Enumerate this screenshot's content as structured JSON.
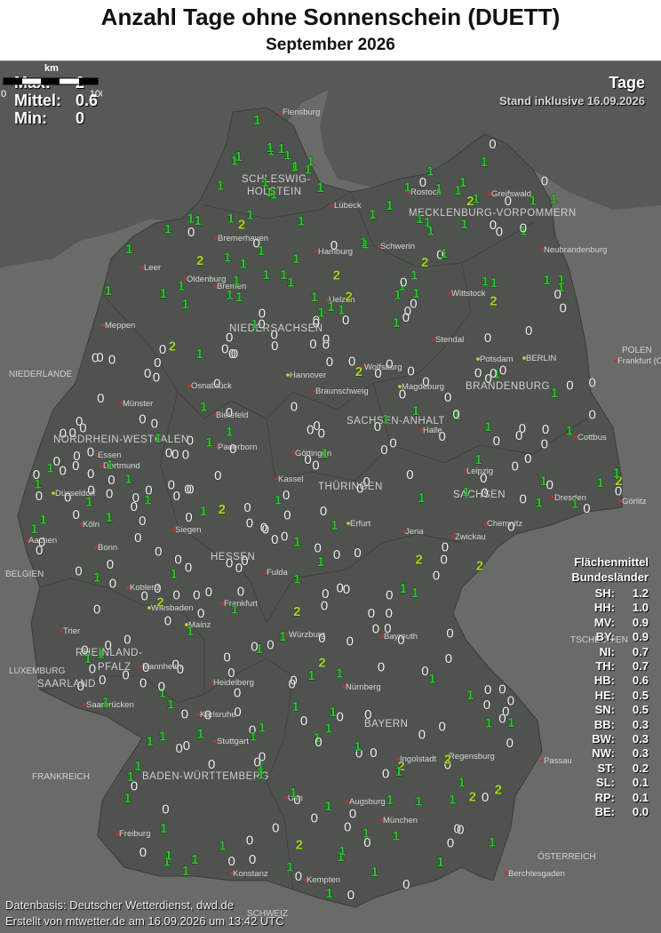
{
  "title": "Anzahl Tage ohne Sonnenschein (DUETT)",
  "subtitle": "September 2026",
  "stats": {
    "max_label": "Max:",
    "max": "2",
    "mean_label": "Mittel:",
    "mean": "0.6",
    "min_label": "Min:",
    "min": "0"
  },
  "unit": "Tage",
  "stand": "Stand inklusive 16.09.2026",
  "legend": {
    "title1": "Flächenmittel",
    "title2": "Bundesländer",
    "rows": [
      {
        "k": "SH:",
        "v": "1.2"
      },
      {
        "k": "HH:",
        "v": "1.0"
      },
      {
        "k": "MV:",
        "v": "0.9"
      },
      {
        "k": "BY:",
        "v": "0.9"
      },
      {
        "k": "NI:",
        "v": "0.7"
      },
      {
        "k": "TH:",
        "v": "0.7"
      },
      {
        "k": "HB:",
        "v": "0.6"
      },
      {
        "k": "HE:",
        "v": "0.5"
      },
      {
        "k": "SN:",
        "v": "0.5"
      },
      {
        "k": "BB:",
        "v": "0.3"
      },
      {
        "k": "BW:",
        "v": "0.3"
      },
      {
        "k": "NW:",
        "v": "0.3"
      },
      {
        "k": "ST:",
        "v": "0.2"
      },
      {
        "k": "SL:",
        "v": "0.1"
      },
      {
        "k": "RP:",
        "v": "0.1"
      },
      {
        "k": "BE:",
        "v": "0.0"
      }
    ]
  },
  "scale": {
    "label": "km",
    "start": "0",
    "end": "100"
  },
  "footer": {
    "line1": "Datenbasis: Deutscher Wetterdienst, dwd.de",
    "line2": "Erstellt von mtwetter.de am 16.09.2026 um 13:42 UTC"
  },
  "places": [
    "Flensburg",
    "Rostock",
    "Greifswald",
    "Lübeck",
    "Schwerin",
    "Neubrandenburg",
    "Hamburg",
    "Bremerhaven",
    "Leer",
    "Oldenburg",
    "Bremen",
    "Uelzen",
    "Wittstock",
    "Meppen",
    "Stendal",
    "Potsdam",
    "BERLIN",
    "Frankfurt (Oder)",
    "Hannover",
    "Wolfsburg",
    "Osnabrück",
    "Braunschweig",
    "Magdeburg",
    "Münster",
    "Bielefeld",
    "Cottbus",
    "Paderborn",
    "Göttingen",
    "Halle",
    "Essen",
    "Dortmund",
    "Leipzig",
    "Düsseldorf",
    "Kassel",
    "Dresden",
    "Görlitz",
    "Erfurt",
    "Siegen",
    "Köln",
    "Jena",
    "Zwickau",
    "Chemnitz",
    "Bonn",
    "Aachen",
    "Fulda",
    "Koblenz",
    "Frankfurt",
    "Wiesbaden",
    "Mainz",
    "Würzburg",
    "Bayreuth",
    "Trier",
    "Mannheim",
    "Nürnberg",
    "Heidelberg",
    "Saarbrücken",
    "Karlsruhe",
    "Stuttgart",
    "Regensburg",
    "Ingolstadt",
    "Passau",
    "Ulm",
    "Augsburg",
    "München",
    "Freiburg",
    "Kempten",
    "Konstanz",
    "Berchtesgaden"
  ],
  "regions": [
    "SCHLESWIG-",
    "HOLSTEIN",
    "MECKLENBURG-VORPOMMERN",
    "NIEDERSACHSEN",
    "BRANDENBURG",
    "SACHSEN-ANHALT",
    "NORDRHEIN-WESTFALEN",
    "THÜRINGEN",
    "SACHSEN",
    "HESSEN",
    "RHEINLAND-",
    "PFALZ",
    "SAARLAND",
    "BAYERN",
    "BADEN-WÜRTTEMBERG"
  ],
  "countries": [
    "NIEDERLANDE",
    "POLEN",
    "BELGIEN",
    "TSCHECHIEN",
    "FRANKREICH",
    "ÖSTERREICH",
    "LUXEMBURG",
    "SCHWEIZ"
  ],
  "stations": [
    [
      2,
      0,
      0
    ],
    [
      2,
      1,
      0
    ],
    [
      2,
      2,
      0
    ],
    [
      1,
      0,
      1
    ],
    [
      1,
      1,
      0
    ],
    [
      2,
      0,
      1
    ],
    [
      1,
      2,
      1
    ],
    [
      2,
      1,
      2
    ],
    [
      1,
      0,
      1
    ],
    [
      1,
      1,
      2
    ],
    [
      1,
      0,
      1
    ],
    [
      1,
      1,
      1
    ],
    [
      2,
      0,
      1
    ],
    [
      1,
      1,
      1
    ],
    [
      1,
      2,
      1
    ],
    [
      1,
      0,
      1
    ],
    [
      1,
      1,
      1
    ],
    [
      0,
      1,
      1
    ],
    [
      1,
      0,
      1
    ],
    [
      1,
      1,
      0
    ],
    [
      1,
      1,
      0
    ],
    [
      1,
      0,
      0
    ],
    [
      0,
      1,
      1
    ],
    [
      1,
      0,
      0
    ],
    [
      0,
      1,
      0
    ],
    [
      1,
      0,
      1
    ],
    [
      0,
      0,
      1
    ],
    [
      1,
      0,
      0
    ],
    [
      0,
      1,
      0
    ],
    [
      0,
      1,
      0
    ]
  ]
}
